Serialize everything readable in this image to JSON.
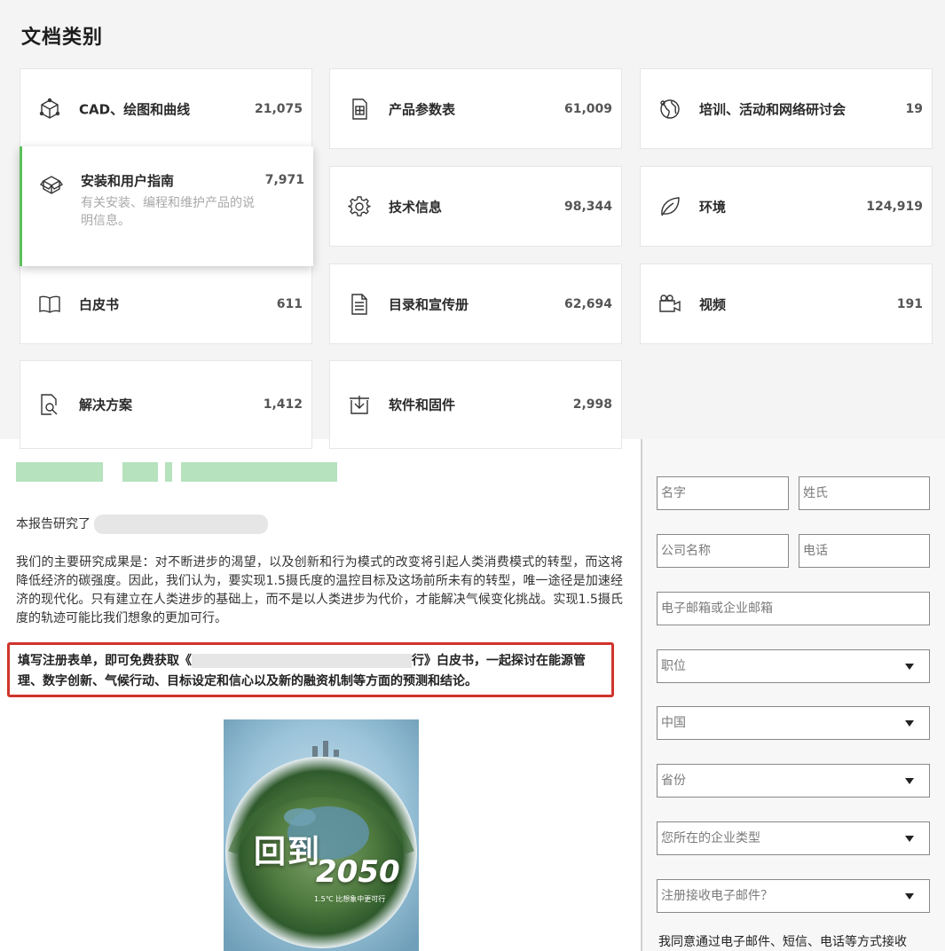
{
  "categories_section": {
    "title": "文档类别",
    "cards": [
      {
        "label": "CAD、绘图和曲线",
        "count": "21,075",
        "icon": "cube-icon"
      },
      {
        "label": "产品参数表",
        "count": "61,009",
        "icon": "datasheet-icon"
      },
      {
        "label": "培训、活动和网络研讨会",
        "count": "19",
        "icon": "globe-icon"
      },
      {
        "label": "安装和用户指南",
        "count": "7,971",
        "icon": "box-icon",
        "description": "有关安装、编程和维护产品的说明信息。",
        "active": true
      },
      {
        "label": "技术信息",
        "count": "98,344",
        "icon": "gear-icon"
      },
      {
        "label": "环境",
        "count": "124,919",
        "icon": "leaf-icon"
      },
      {
        "label": "白皮书",
        "count": "611",
        "icon": "book-icon"
      },
      {
        "label": "目录和宣传册",
        "count": "62,694",
        "icon": "document-icon"
      },
      {
        "label": "视频",
        "count": "191",
        "icon": "video-icon"
      },
      {
        "label": "解决方案",
        "count": "1,412",
        "icon": "doc-search-icon"
      },
      {
        "label": "软件和固件",
        "count": "2,998",
        "icon": "download-icon"
      }
    ]
  },
  "article": {
    "intro": "本报告研究了",
    "body": "我们的主要研究成果是：对不断进步的渴望，以及创新和行为模式的改变将引起人类消费模式的转型，而这将降低经济的碳强度。因此，我们认为，要实现1.5摄氏度的温控目标及这场前所未有的转型，唯一途径是加速经济的现代化。只有建立在人类进步的基础上，而不是以人类进步为代价，才能解决气候变化挑战。实现1.5摄氏度的轨迹可能比我们想象的更加可行。",
    "highlight_prefix": "填写注册表单，即可免费获取《",
    "highlight_mid": "行》白皮书，一起探讨在能源管理、数字创新、气候行动、目标设定和信心以及新的融资机制等方面的预测和结论。",
    "cover": {
      "title_line1": "回到",
      "title_line2": "2050",
      "subtitle": "1.5℃ 比想象中更可行"
    }
  },
  "form": {
    "first_name_placeholder": "名字",
    "last_name_placeholder": "姓氏",
    "company_placeholder": "公司名称",
    "phone_placeholder": "电话",
    "email_placeholder": "电子邮箱或企业邮箱",
    "job_select": "职位",
    "country_select": "中国",
    "province_select": "省份",
    "company_type_select": "您所在的企业类型",
    "newsletter_select": "注册接收电子邮件？",
    "consent_text": "我同意通过电子邮件、短信、电话等方式接收"
  }
}
